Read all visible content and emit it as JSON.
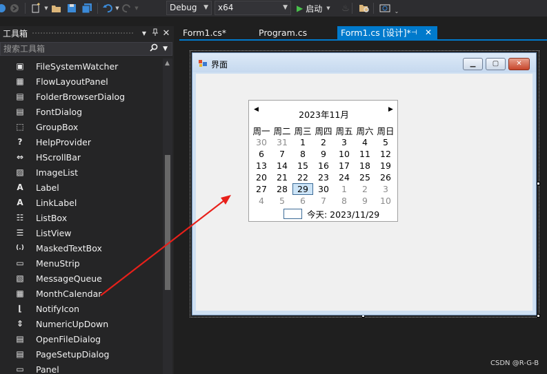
{
  "toolbar": {
    "config_value": "Debug",
    "platform_value": "x64",
    "start_label": "启动",
    "icons": [
      "back-icon",
      "forward-icon",
      "new-project-icon",
      "open-file-icon",
      "save-icon",
      "save-all-icon",
      "undo-icon",
      "redo-icon",
      "start-icon",
      "hot-reload-icon",
      "find-in-files-icon",
      "screenshot-icon"
    ]
  },
  "toolbox": {
    "title": "工具箱",
    "search_placeholder": "搜索工具箱",
    "items": [
      {
        "label": "FileSystemWatcher",
        "icon": "filesystemwatcher-icon"
      },
      {
        "label": "FlowLayoutPanel",
        "icon": "flowlayoutpanel-icon"
      },
      {
        "label": "FolderBrowserDialog",
        "icon": "folderbrowserdialog-icon"
      },
      {
        "label": "FontDialog",
        "icon": "fontdialog-icon"
      },
      {
        "label": "GroupBox",
        "icon": "groupbox-icon"
      },
      {
        "label": "HelpProvider",
        "icon": "helpprovider-icon"
      },
      {
        "label": "HScrollBar",
        "icon": "hscrollbar-icon"
      },
      {
        "label": "ImageList",
        "icon": "imagelist-icon"
      },
      {
        "label": "Label",
        "icon": "label-icon"
      },
      {
        "label": "LinkLabel",
        "icon": "linklabel-icon"
      },
      {
        "label": "ListBox",
        "icon": "listbox-icon"
      },
      {
        "label": "ListView",
        "icon": "listview-icon"
      },
      {
        "label": "MaskedTextBox",
        "icon": "maskedtextbox-icon"
      },
      {
        "label": "MenuStrip",
        "icon": "menustrip-icon"
      },
      {
        "label": "MessageQueue",
        "icon": "messagequeue-icon"
      },
      {
        "label": "MonthCalendar",
        "icon": "monthcalendar-icon"
      },
      {
        "label": "NotifyIcon",
        "icon": "notifyicon-icon"
      },
      {
        "label": "NumericUpDown",
        "icon": "numericupdown-icon"
      },
      {
        "label": "OpenFileDialog",
        "icon": "openfiledialog-icon"
      },
      {
        "label": "PageSetupDialog",
        "icon": "pagesetupdialog-icon"
      },
      {
        "label": "Panel",
        "icon": "panel-icon"
      }
    ]
  },
  "tabs": [
    {
      "label": "Form1.cs*",
      "active": false
    },
    {
      "label": "Program.cs",
      "active": false
    },
    {
      "label": "Form1.cs [设计]*",
      "active": true
    }
  ],
  "form": {
    "title": "界面"
  },
  "calendar": {
    "month_label": "2023年11月",
    "weekdays": [
      "周一",
      "周二",
      "周三",
      "周四",
      "周五",
      "周六",
      "周日"
    ],
    "weeks": [
      [
        "30",
        "31",
        "1",
        "2",
        "3",
        "4",
        "5"
      ],
      [
        "6",
        "7",
        "8",
        "9",
        "10",
        "11",
        "12"
      ],
      [
        "13",
        "14",
        "15",
        "16",
        "17",
        "18",
        "19"
      ],
      [
        "20",
        "21",
        "22",
        "23",
        "24",
        "25",
        "26"
      ],
      [
        "27",
        "28",
        "29",
        "30",
        "1",
        "2",
        "3"
      ],
      [
        "4",
        "5",
        "6",
        "7",
        "8",
        "9",
        "10"
      ]
    ],
    "today_label": "今天: 2023/11/29"
  },
  "watermark": "CSDN @R-G-B",
  "colors": {
    "accent": "#007acc",
    "arrow": "#e8201a"
  }
}
